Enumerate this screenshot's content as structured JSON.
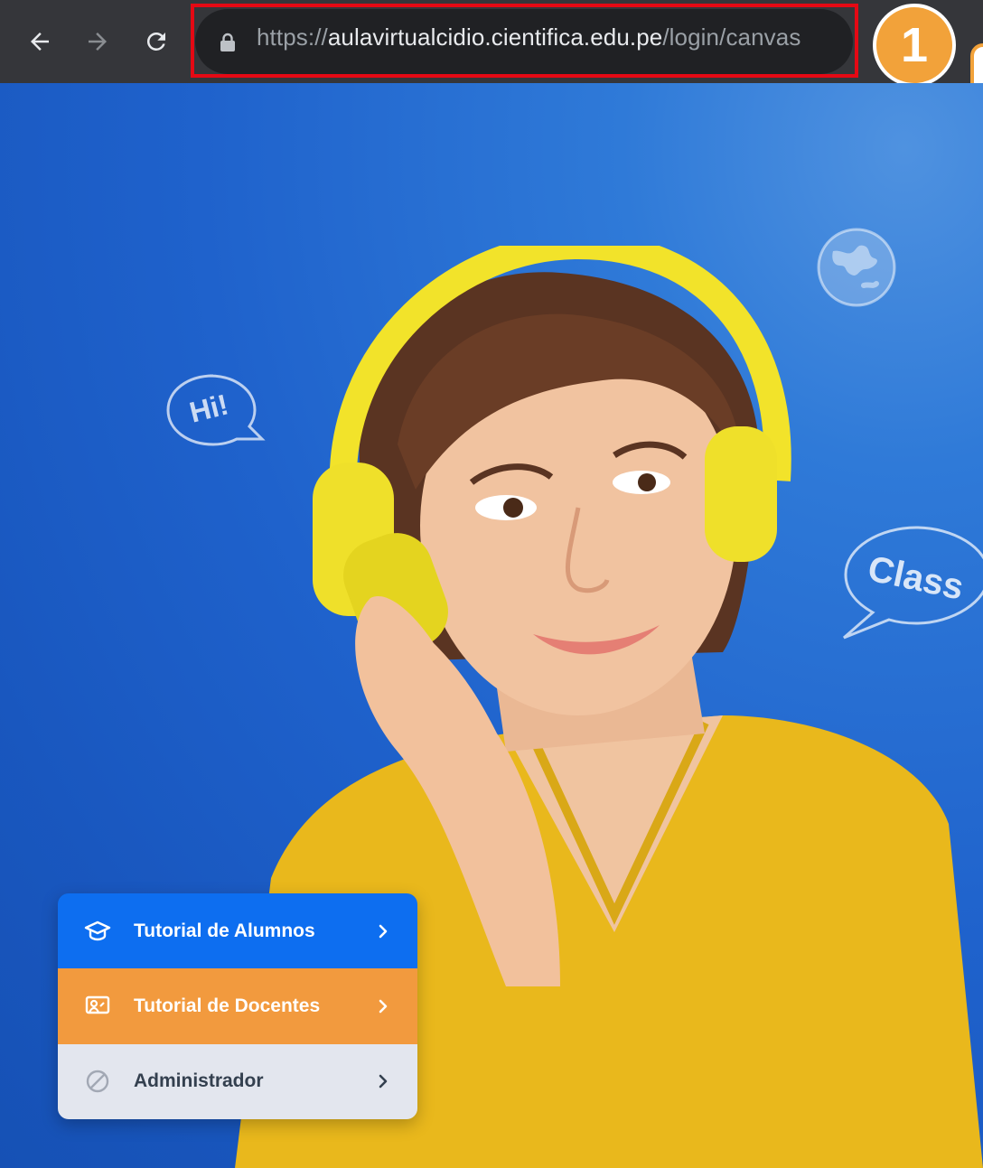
{
  "browser": {
    "url_scheme": "https://",
    "url_domain": "aulavirtualcidio.cientifica.edu.pe",
    "url_path": "/login/canvas",
    "step_badge": "1",
    "highlight_color": "#e50914"
  },
  "hero": {
    "bubble_hi": "Hi!",
    "bubble_class": "Class"
  },
  "menu": {
    "items": [
      {
        "label": "Tutorial de Alumnos",
        "icon": "graduation-cap-icon",
        "color": "#0d6ef0"
      },
      {
        "label": "Tutorial de Docentes",
        "icon": "presentation-icon",
        "color": "#f29a3e"
      },
      {
        "label": "Administrador",
        "icon": "disabled-icon",
        "color": "#e3e6ee"
      }
    ]
  }
}
